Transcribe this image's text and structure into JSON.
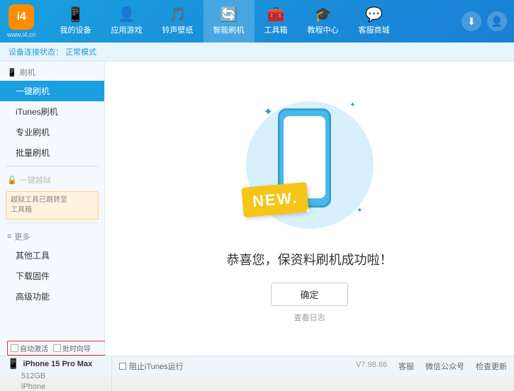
{
  "header": {
    "logo_char": "i4",
    "logo_subtext": "www.i4.cn",
    "nav_tabs": [
      {
        "id": "my-device",
        "label": "我的设备",
        "icon": "📱"
      },
      {
        "id": "apps-games",
        "label": "应用游戏",
        "icon": "👤"
      },
      {
        "id": "ringtones",
        "label": "铃声壁纸",
        "icon": "📋"
      },
      {
        "id": "smart-flash",
        "label": "智能刷机",
        "icon": "🔄",
        "active": true
      },
      {
        "id": "toolbox",
        "label": "工具箱",
        "icon": "🧰"
      },
      {
        "id": "tutorials",
        "label": "教程中心",
        "icon": "🎓"
      },
      {
        "id": "service",
        "label": "客服商城",
        "icon": "💬"
      }
    ],
    "btn_download": "⬇",
    "btn_user": "👤"
  },
  "breadcrumb": {
    "prefix": "设备连接状态：",
    "status": "正常模式"
  },
  "sidebar": {
    "section1": {
      "icon": "📱",
      "label": "刷机",
      "items": [
        {
          "id": "one-click-flash",
          "label": "一键刷机",
          "active": true
        },
        {
          "id": "itunes-flash",
          "label": "iTunes刷机"
        },
        {
          "id": "pro-flash",
          "label": "专业刷机"
        },
        {
          "id": "batch-flash",
          "label": "批量刷机"
        }
      ]
    },
    "section2": {
      "icon": "🔓",
      "label": "一键越狱",
      "disabled": true,
      "notice_line1": "越狱工具已跳转至",
      "notice_line2": "工具箱"
    },
    "section3": {
      "icon": "≡",
      "label": "更多",
      "items": [
        {
          "id": "other-tools",
          "label": "其他工具"
        },
        {
          "id": "download-firm",
          "label": "下载固件"
        },
        {
          "id": "advanced",
          "label": "高级功能"
        }
      ]
    }
  },
  "content": {
    "success_text": "恭喜您，保资料刷机成功啦！",
    "confirm_btn": "确定",
    "log_link": "查看日志",
    "new_badge": "NEW."
  },
  "bottom": {
    "checkbox1_label": "自动激活",
    "checkbox2_label": "批时向导",
    "device_icon": "📱",
    "device_name": "iPhone 15 Pro Max",
    "device_storage": "512GB",
    "device_type": "iPhone",
    "itunes_checkbox_label": "阻止iTunes运行",
    "version": "V7.98.66",
    "links": [
      "客服",
      "微信公众号",
      "检查更新"
    ]
  }
}
